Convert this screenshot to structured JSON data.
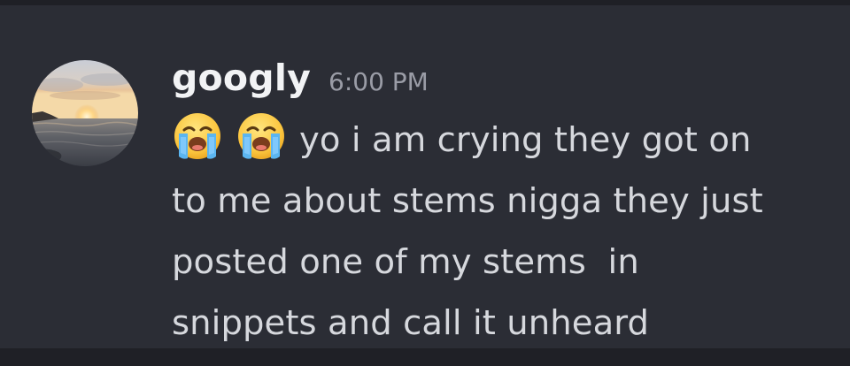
{
  "message": {
    "author": "googly",
    "timestamp": "6:00 PM",
    "leading_emojis": [
      "loudly-crying-face",
      "loudly-crying-face"
    ],
    "text_lines": [
      "yo i am crying they got on",
      "to me about stems nigga they just",
      "posted one of my stems  in",
      "snippets and call it unheard"
    ]
  },
  "avatar": {
    "icon": "sunset-over-sea-avatar"
  },
  "colors": {
    "background": "#2b2d35",
    "username": "#f2f3f5",
    "timestamp": "#9a9ca6",
    "text": "#d6d8dd"
  }
}
